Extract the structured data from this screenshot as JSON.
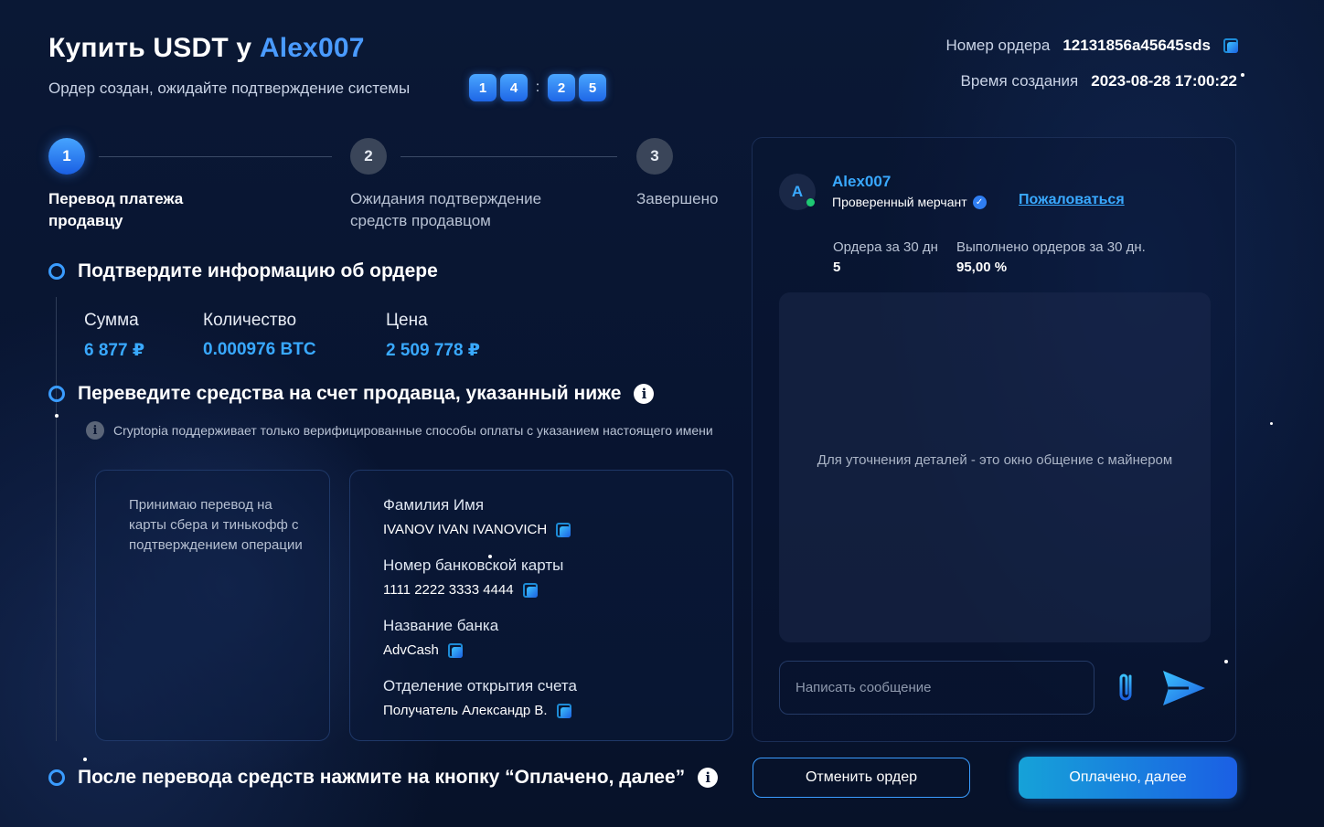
{
  "header": {
    "title_prefix": "Купить USDT у",
    "title_merchant": "Alex007",
    "subtitle": "Ордер создан, ожидайте подтверждение системы",
    "timer": {
      "d1": "1",
      "d2": "4",
      "sep": ":",
      "d3": "2",
      "d4": "5"
    },
    "order_number_label": "Номер ордера",
    "order_number": "12131856a45645sds",
    "created_label": "Время создания",
    "created_value": "2023-08-28 17:00:22"
  },
  "steps": [
    {
      "num": "1",
      "label": "Перевод платежа продавцу",
      "state": "active"
    },
    {
      "num": "2",
      "label": "Ожидания подтверждение средств продавцом",
      "state": "idle"
    },
    {
      "num": "3",
      "label": "Завершено",
      "state": "idle"
    }
  ],
  "confirm": {
    "title": "Подтвердите информацию об ордере",
    "amount_label": "Сумма",
    "amount_value": "6 877 ₽",
    "quantity_label": "Количество",
    "quantity_value": "0.000976 BTC",
    "price_label": "Цена",
    "price_value": "2 509 778 ₽"
  },
  "transfer": {
    "title": "Переведите средства на счет продавца, указанный ниже",
    "note": "Cryptopia поддерживает только верифицированные способы оплаты с указанием настоящего имени",
    "seller_note": "Принимаю перевод на карты сбера и тинькофф с подтверждением операции",
    "fields": [
      {
        "label": "Фамилия Имя",
        "value": "IVANOV IVAN IVANOVICH"
      },
      {
        "label": "Номер банковской карты",
        "value": "1111 2222 3333 4444"
      },
      {
        "label": "Название банка",
        "value": "AdvCash"
      },
      {
        "label": "Отделение открытия счета",
        "value": "Получатель Александр В."
      }
    ]
  },
  "after": {
    "title": "После перевода средств нажмите на кнопку “Оплачено, далее”"
  },
  "merchant": {
    "avatar_letter": "A",
    "name": "Alex007",
    "status": "Проверенный мерчант",
    "complain": "Пожаловаться",
    "orders_label": "Ордера за 30 дн",
    "orders_value": "5",
    "completed_label": "Выполнено ордеров за 30 дн.",
    "completed_value": "95,00 %"
  },
  "chat": {
    "hint": "Для уточнения деталей - это окно общение с майнером",
    "placeholder": "Написать сообщение"
  },
  "buttons": {
    "cancel": "Отменить ордер",
    "paid": "Оплачено, далее"
  },
  "colors": {
    "accent": "#39a9ff",
    "background": "#08142e",
    "online": "#1ec973"
  }
}
